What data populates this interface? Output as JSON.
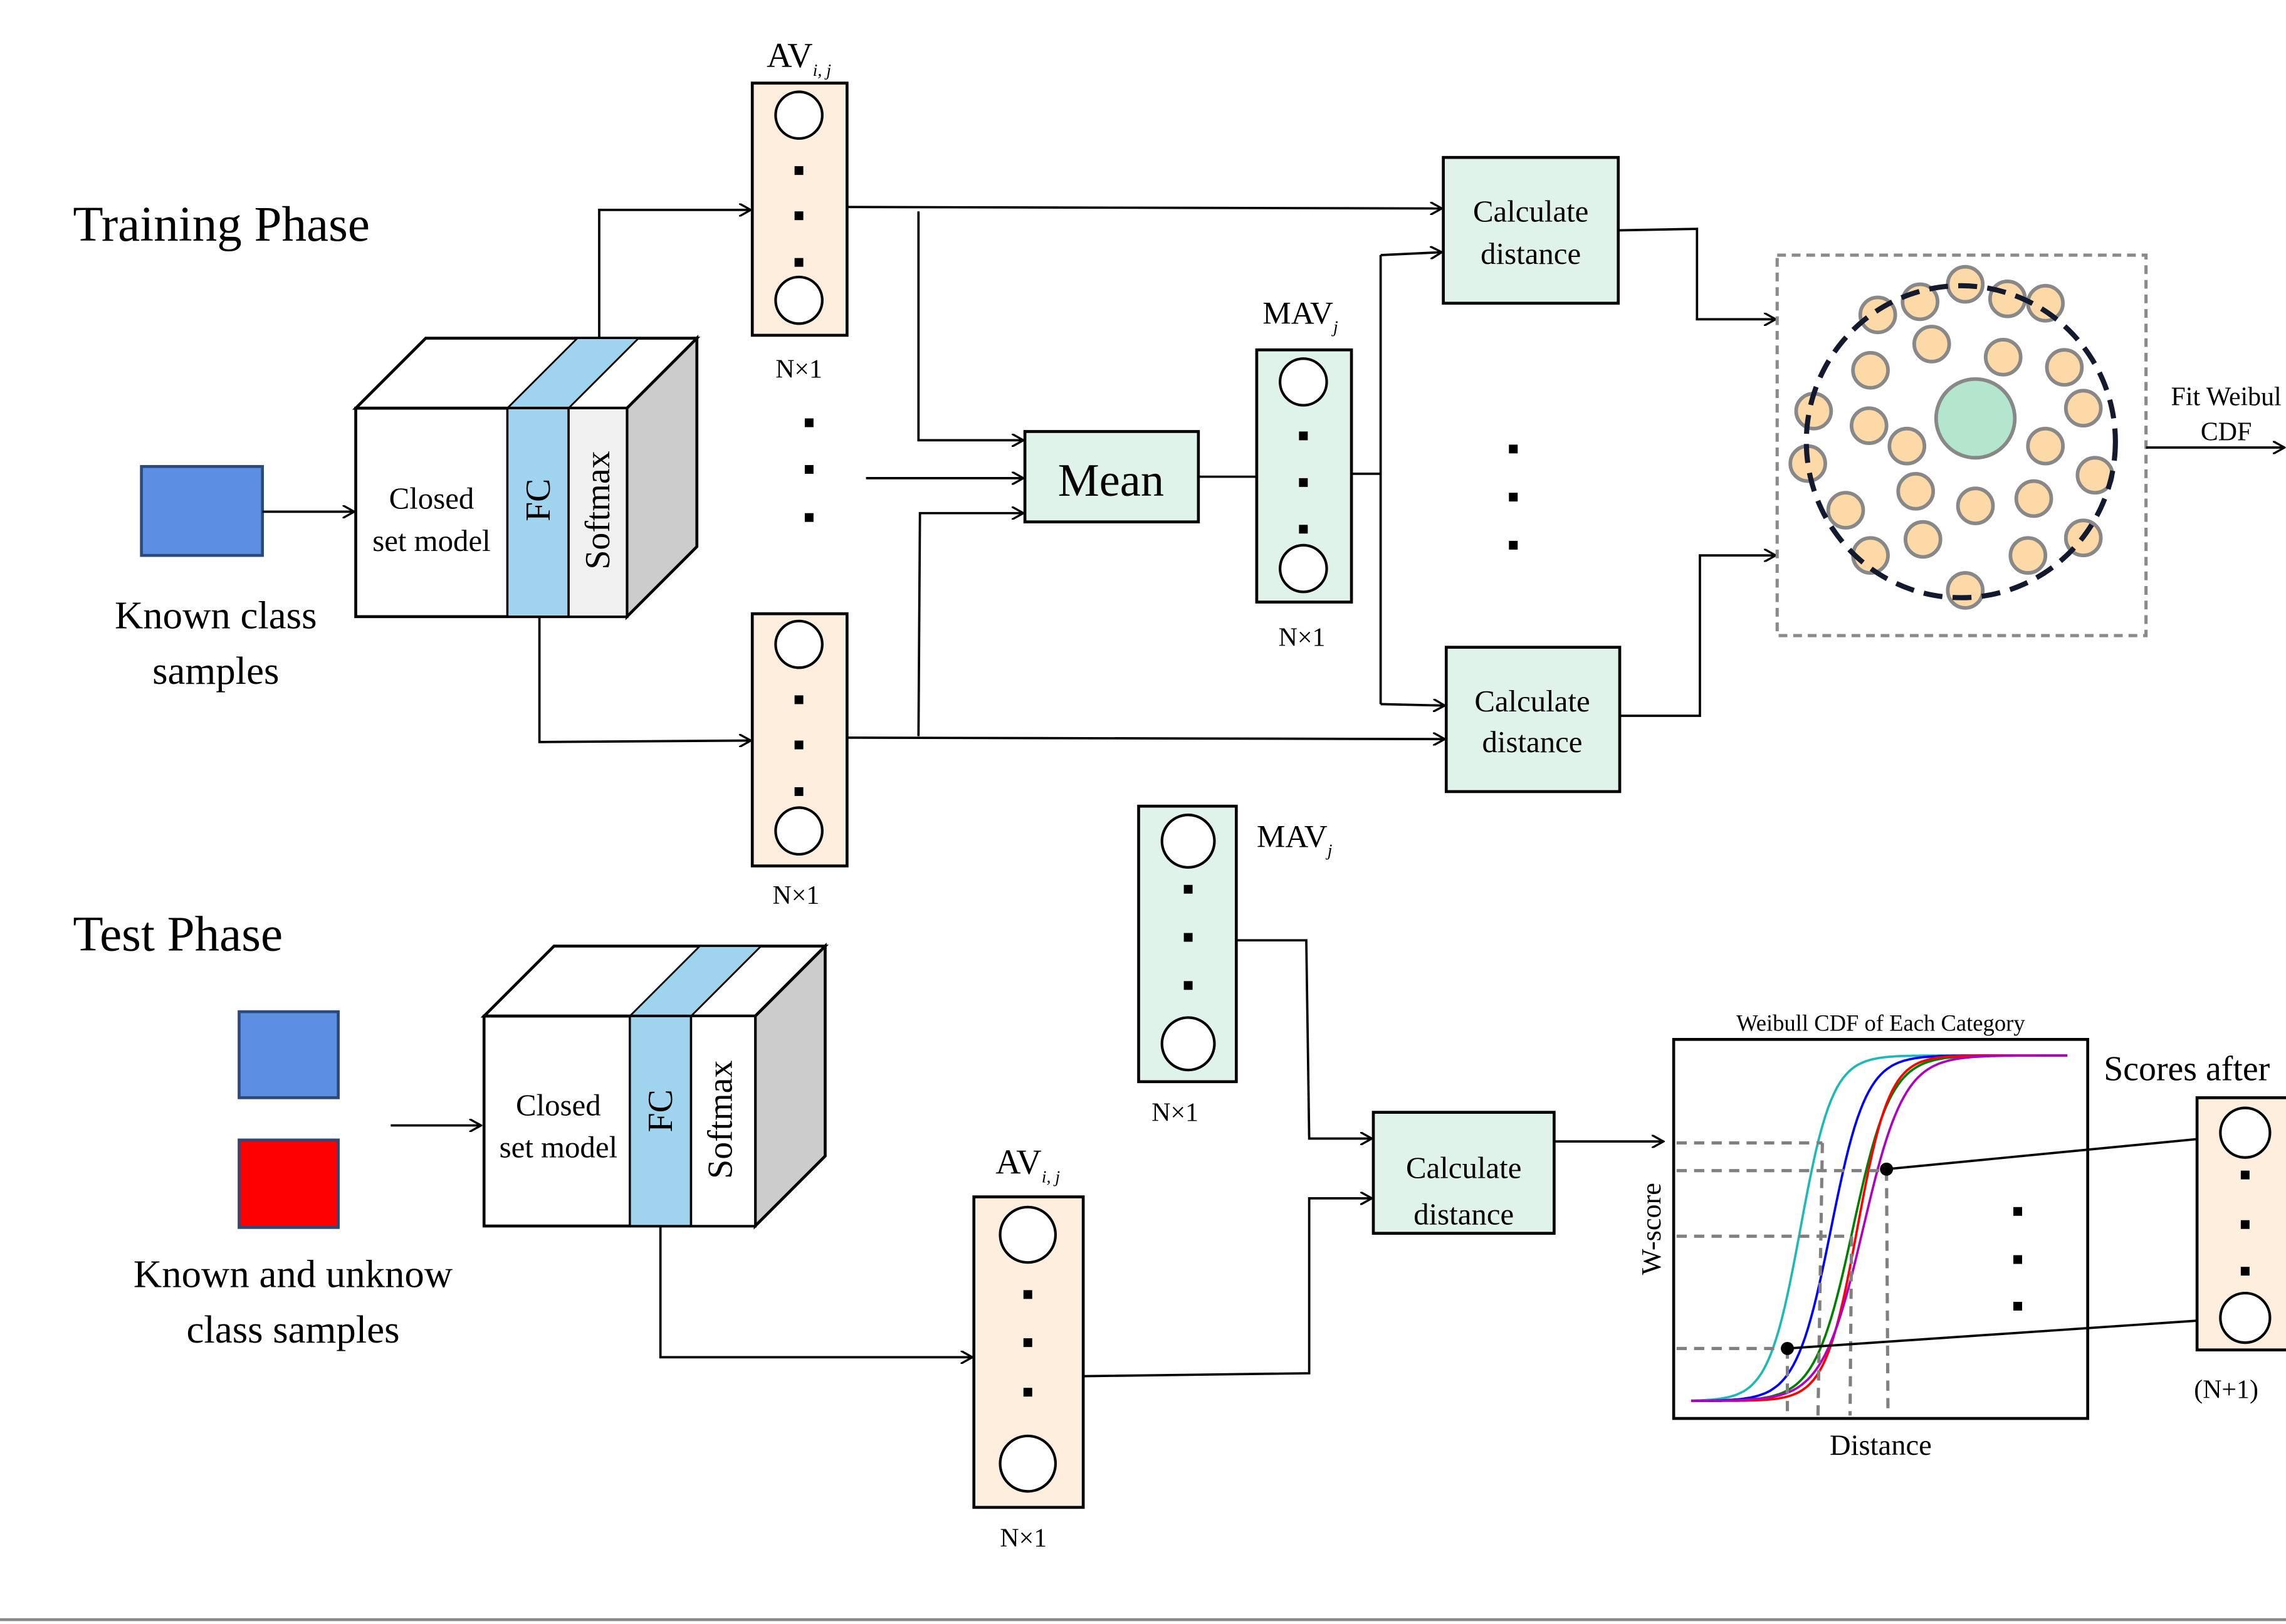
{
  "training": {
    "title": "Training Phase",
    "input_label": [
      "Known class",
      "samples"
    ],
    "model": {
      "line1": "Closed",
      "line2": "set model",
      "fc": "FC",
      "softmax": "Softmax"
    },
    "av_label": {
      "main": "AV",
      "sub": "i, j"
    },
    "av_size": "N×1",
    "av_size_bottom": "N×1",
    "mean_label": "Mean",
    "mav_label": {
      "main": "MAV",
      "sub": "j"
    },
    "mav_size": "N×1",
    "calc_distance": [
      "Calculate",
      "distance"
    ],
    "fit_label": [
      "Fit Weibul",
      "CDF"
    ]
  },
  "test": {
    "title": "Test Phase",
    "input_label": [
      "Known and unknow",
      "class samples"
    ],
    "model": {
      "line1": "Closed",
      "line2": "set model",
      "fc": "FC",
      "softmax": "Softmax"
    },
    "mav_label": {
      "main": "MAV",
      "sub": "j"
    },
    "mav_size": "N×1",
    "av_label": {
      "main": "AV",
      "sub": "i, j"
    },
    "av_size": "N×1",
    "calc_distance": [
      "Calculate",
      "distance"
    ],
    "weibull_plot": {
      "title": "Weibull CDF of Each Category",
      "xlabel": "Distance",
      "ylabel": "W-score"
    },
    "scores_label": "Scores after",
    "scores_size": "(N+1)"
  },
  "colors": {
    "known_sample": "#5b8fe3",
    "unknown_sample": "#ff0000",
    "fc_layer": "#9fd3ee",
    "softmax_layer": "#f0f0f0",
    "cube_side": "#cccccc",
    "activation_box": "#fdeedd",
    "mav_box": "#dff3ea",
    "cluster_point": "#fdd9a8",
    "cluster_center": "#b3e6cc",
    "curves": [
      "#1fb8b8",
      "#0000ff",
      "#008000",
      "#ff0000",
      "#b000c0"
    ]
  }
}
